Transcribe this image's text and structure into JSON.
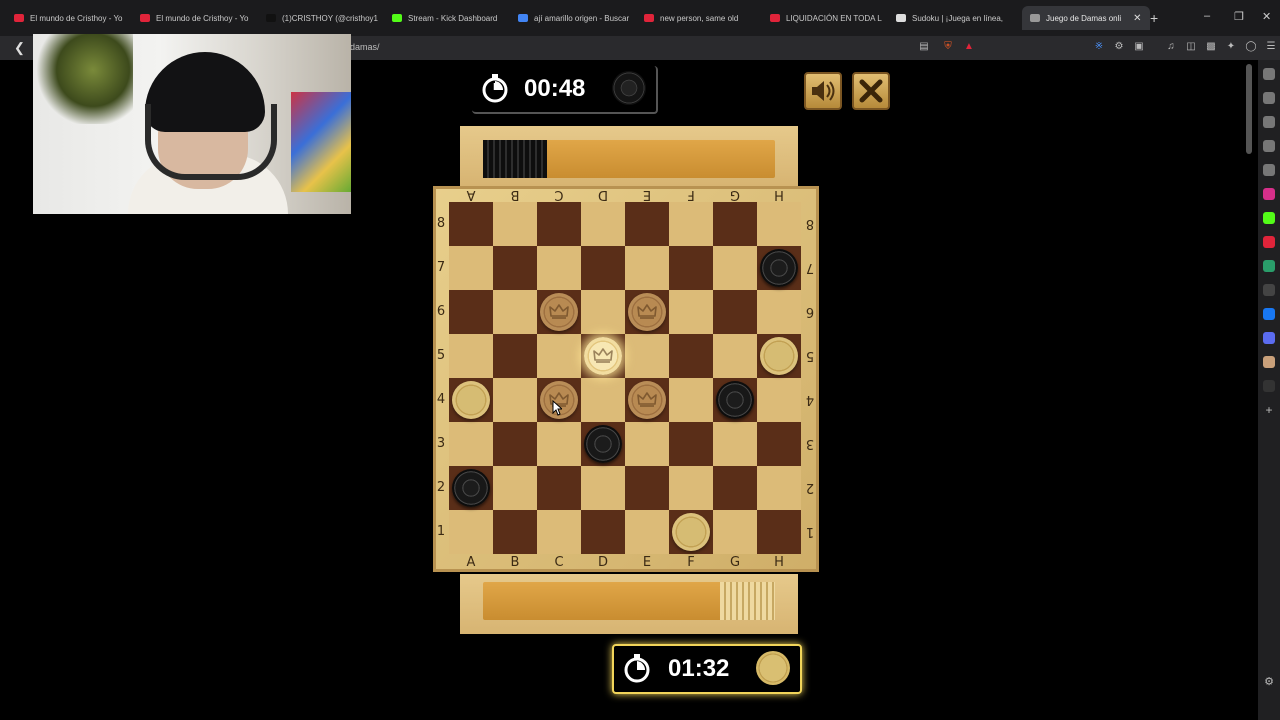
{
  "browser": {
    "tabs": [
      {
        "title": "El mundo de Cristhoy - Yo",
        "icon_color": "#e0243a"
      },
      {
        "title": "El mundo de Cristhoy - Yo",
        "icon_color": "#e0243a"
      },
      {
        "title": "(1)CRISTHOY (@cristhoy1(",
        "icon_color": "#111111"
      },
      {
        "title": "Stream - Kick Dashboard",
        "icon_color": "#53fc18"
      },
      {
        "title": "ají amarillo origen - Buscar",
        "icon_color": "#4285f4"
      },
      {
        "title": "new person, same old",
        "icon_color": "#e0243a"
      },
      {
        "title": "LIQUIDACIÓN EN TODA LA",
        "icon_color": "#e0243a"
      },
      {
        "title": "Sudoku | ¡Juega en línea,",
        "icon_color": "#dddddd"
      },
      {
        "title": "Juego de Damas onli",
        "icon_color": "#999999"
      }
    ],
    "new_tab": "+",
    "url": "damas/",
    "window_controls": {
      "minimize": "–",
      "restore": "❐",
      "close": "✕"
    }
  },
  "game": {
    "top_timer": {
      "time": "00:48",
      "piece": "black"
    },
    "bottom_timer": {
      "time": "01:32",
      "piece": "tan",
      "active": true
    },
    "sound_button": "speaker-icon",
    "close_button": "close-icon",
    "captured_black_fraction": 0.22,
    "captured_tan_fraction": 0.19,
    "columns": [
      "A",
      "B",
      "C",
      "D",
      "E",
      "F",
      "G",
      "H"
    ],
    "rows": [
      "8",
      "7",
      "6",
      "5",
      "4",
      "3",
      "2",
      "1"
    ],
    "pieces": [
      {
        "square": "H7",
        "color": "black",
        "king": false
      },
      {
        "square": "C6",
        "color": "brown",
        "king": true
      },
      {
        "square": "E6",
        "color": "brown",
        "king": true
      },
      {
        "square": "D5",
        "color": "highlight",
        "king": true
      },
      {
        "square": "H5",
        "color": "tan",
        "king": false
      },
      {
        "square": "A4",
        "color": "tan",
        "king": false
      },
      {
        "square": "C4",
        "color": "brown",
        "king": true
      },
      {
        "square": "E4",
        "color": "brown",
        "king": true
      },
      {
        "square": "G4",
        "color": "black",
        "king": false
      },
      {
        "square": "D3",
        "color": "black",
        "king": false
      },
      {
        "square": "A2",
        "color": "black",
        "king": false
      },
      {
        "square": "F1",
        "color": "tan",
        "king": false
      }
    ],
    "colors": {
      "light_square": "#dcbb78",
      "dark_square": "#5a2e18",
      "active_timer_border": "#f2d55a"
    }
  }
}
